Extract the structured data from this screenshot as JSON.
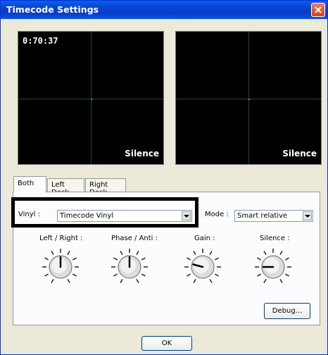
{
  "window": {
    "title": "Timecode Settings"
  },
  "scopes": {
    "left": {
      "time": "0:70:37",
      "status": "Silence"
    },
    "right": {
      "time": "",
      "status": "Silence"
    }
  },
  "tabs": [
    {
      "label": "Both",
      "active": true
    },
    {
      "label": "Left Deck",
      "active": false
    },
    {
      "label": "Right Deck",
      "active": false
    }
  ],
  "vinyl": {
    "label": "Vinyl :",
    "value": "Timecode Vinyl"
  },
  "mode": {
    "label": "Mode :",
    "value": "Smart relative"
  },
  "knobs": [
    {
      "label": "Left / Right :",
      "level": 0.5
    },
    {
      "label": "Phase / Anti :",
      "level": 0.5
    },
    {
      "label": "Gain :",
      "level": 0.25
    },
    {
      "label": "Silence :",
      "level": 0.2
    }
  ],
  "buttons": {
    "debug": "Debug...",
    "ok": "OK"
  },
  "colors": {
    "titlebar": "#0a3fd0",
    "panel": "#fcfcfe",
    "scope_bg": "#000000",
    "grid": "#1d4a2a"
  }
}
